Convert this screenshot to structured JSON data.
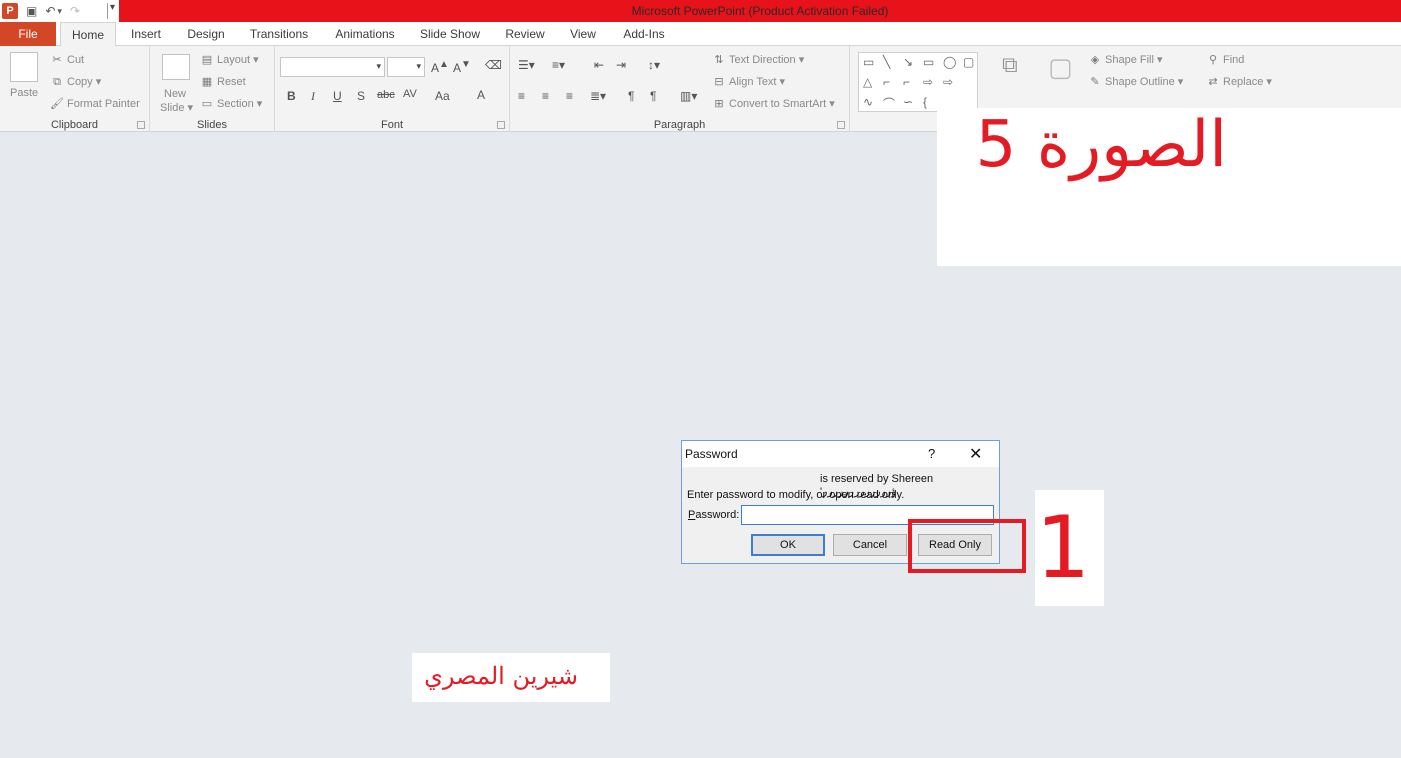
{
  "window": {
    "title": "Microsoft PowerPoint (Product Activation Failed)",
    "app_icon_letter": "P",
    "brand_color": "#d24726",
    "title_bar_color": "#e8121a"
  },
  "tabs": [
    {
      "label": "File"
    },
    {
      "label": "Home"
    },
    {
      "label": "Insert"
    },
    {
      "label": "Design"
    },
    {
      "label": "Transitions"
    },
    {
      "label": "Animations"
    },
    {
      "label": "Slide Show"
    },
    {
      "label": "Review"
    },
    {
      "label": "View"
    },
    {
      "label": "Add-Ins"
    }
  ],
  "ribbon": {
    "clipboard": {
      "label": "Clipboard",
      "paste": "Paste",
      "cut": "Cut",
      "copy": "Copy",
      "format_painter": "Format Painter"
    },
    "slides": {
      "label": "Slides",
      "new_slide_line1": "New",
      "new_slide_line2": "Slide",
      "layout": "Layout",
      "reset": "Reset",
      "section": "Section"
    },
    "font": {
      "label": "Font",
      "bold": "B",
      "italic": "I",
      "underline": "U",
      "shadow": "S",
      "strike": "abc",
      "spacing": "AV",
      "case": "Aa",
      "color": "A"
    },
    "paragraph": {
      "label": "Paragraph",
      "text_direction": "Text Direction",
      "align_text": "Align Text",
      "convert_smartart": "Convert to SmartArt"
    },
    "drawing": {
      "shape_fill": "Shape Fill",
      "shape_outline": "Shape Outline"
    },
    "editing": {
      "find": "Find",
      "replace": "Replace"
    }
  },
  "dialog": {
    "title": "Password",
    "help": "?",
    "close": "✕",
    "reserved_line": "is reserved by Shereen 'ؤررررررررررررر",
    "instruction": "Enter password to modify, or open read only.",
    "password_label": "Password:",
    "password_value": "",
    "ok": "OK",
    "cancel": "Cancel",
    "read_only": "Read Only"
  },
  "annotations": {
    "caption": "الصورة 5",
    "step_number": "1",
    "signature": "شيرين المصري",
    "accent": "#e41b23"
  }
}
